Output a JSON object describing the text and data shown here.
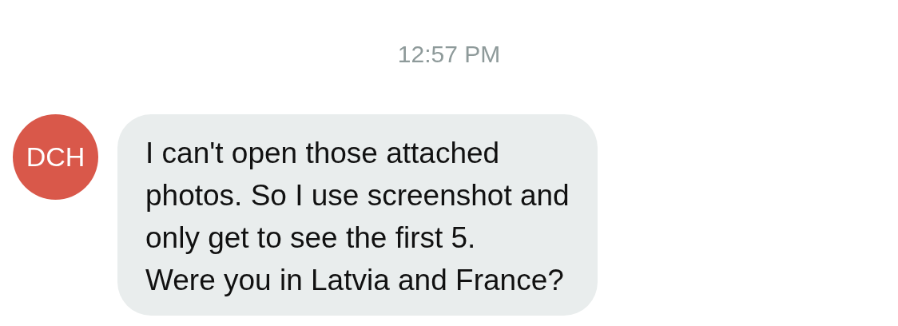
{
  "timestamp": "12:57 PM",
  "messages": [
    {
      "sender_initials": "DCH",
      "text": "I can't open those attached\nphotos. So I use screenshot and\nonly get to see the first 5.\nWere you in Latvia and France?"
    }
  ]
}
